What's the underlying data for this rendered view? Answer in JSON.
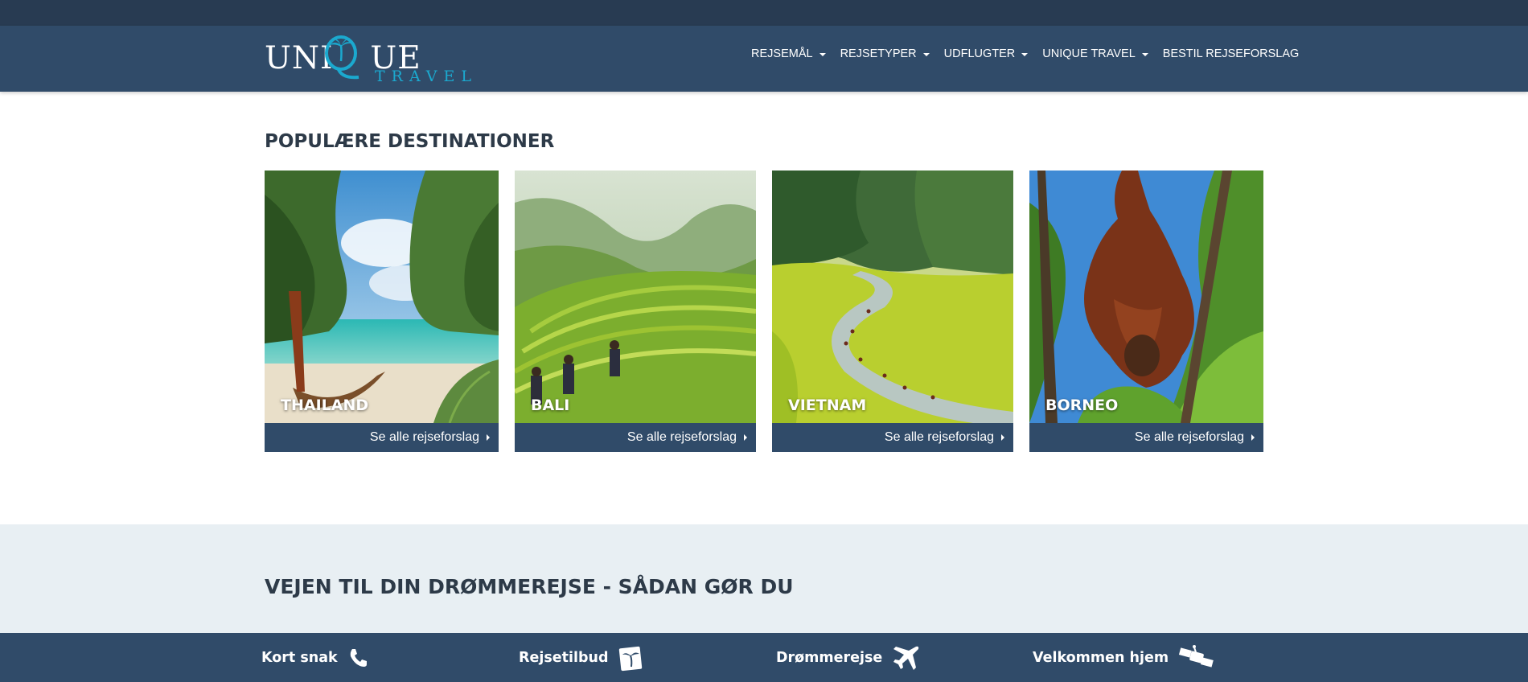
{
  "header": {
    "logo": {
      "main": "UNIQUE",
      "sub": "TRAVEL"
    },
    "menu": [
      {
        "label": "REJSEMÅL",
        "dropdown": true
      },
      {
        "label": "REJSETYPER",
        "dropdown": true
      },
      {
        "label": "UDFLUGTER",
        "dropdown": true
      },
      {
        "label": "UNIQUE TRAVEL",
        "dropdown": true
      },
      {
        "label": "BESTIL REJSEFORSLAG",
        "dropdown": false
      }
    ]
  },
  "destinations": {
    "title": "POPULÆRE DESTINATIONER",
    "cards": [
      {
        "name": "THAILAND",
        "link": "Se alle rejseforslag"
      },
      {
        "name": "BALI",
        "link": "Se alle rejseforslag"
      },
      {
        "name": "VIETNAM",
        "link": "Se alle rejseforslag"
      },
      {
        "name": "BORNEO",
        "link": "Se alle rejseforslag"
      }
    ]
  },
  "steps_section": {
    "title": "VEJEN TIL DIN DRØMMEREJSE - SÅDAN GØR DU",
    "steps": [
      {
        "label": "Kort snak",
        "icon": "phone-icon"
      },
      {
        "label": "Rejsetilbud",
        "icon": "palm-card-icon"
      },
      {
        "label": "Drømmerejse",
        "icon": "airplane-icon"
      },
      {
        "label": "Velkommen hjem",
        "icon": "satellite-icon"
      }
    ]
  },
  "colors": {
    "topstrip": "#283b52",
    "navbar": "#304b69",
    "accent": "#1ba9cf",
    "band": "#e8eff3",
    "heading": "#2d3a48"
  }
}
